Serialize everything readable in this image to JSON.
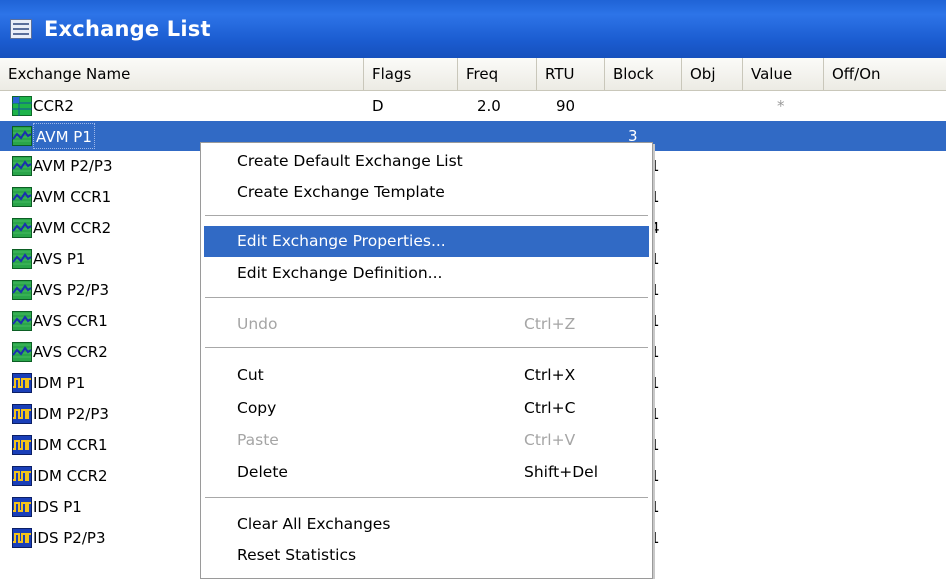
{
  "window": {
    "title": "Exchange List",
    "icon": "list-window-icon"
  },
  "columns": [
    "Exchange Name",
    "Flags",
    "Freq",
    "RTU",
    "Block",
    "Obj",
    "Value",
    "Off/On"
  ],
  "rows": [
    {
      "name": "CCR2",
      "icon": "grid-table-icon",
      "flags": "D",
      "freq": "2.0",
      "rtu": "90",
      "block": "",
      "obj": "",
      "value": "*",
      "selected": false
    },
    {
      "name": "AVM P1",
      "icon": "analog-wave-icon",
      "flags": "",
      "freq": "",
      "rtu": "",
      "block": "3",
      "obj": "",
      "value": "",
      "selected": true
    },
    {
      "name": "AVM P2/P3",
      "icon": "analog-wave-icon",
      "block": "1"
    },
    {
      "name": "AVM CCR1",
      "icon": "analog-wave-icon",
      "block": "1"
    },
    {
      "name": "AVM CCR2",
      "icon": "analog-wave-icon",
      "block": "4"
    },
    {
      "name": "AVS P1",
      "icon": "analog-wave-icon",
      "block": "1"
    },
    {
      "name": "AVS P2/P3",
      "icon": "analog-wave-icon",
      "block": "1"
    },
    {
      "name": "AVS CCR1",
      "icon": "analog-wave-icon",
      "block": "1"
    },
    {
      "name": "AVS CCR2",
      "icon": "analog-wave-icon",
      "block": "1"
    },
    {
      "name": "IDM P1",
      "icon": "digital-pulse-icon",
      "block": "1"
    },
    {
      "name": "IDM P2/P3",
      "icon": "digital-pulse-icon",
      "block": "1"
    },
    {
      "name": "IDM CCR1",
      "icon": "digital-pulse-icon",
      "block": "1"
    },
    {
      "name": "IDM CCR2",
      "icon": "digital-pulse-icon",
      "block": "1"
    },
    {
      "name": "IDS P1",
      "icon": "digital-pulse-icon",
      "block": "1"
    },
    {
      "name": "IDS P2/P3",
      "icon": "digital-pulse-icon",
      "block": "1"
    }
  ],
  "context_menu": {
    "items": [
      {
        "label": "Create Default Exchange List",
        "shortcut": "",
        "state": "normal"
      },
      {
        "label": "Create Exchange Template",
        "shortcut": "",
        "state": "normal"
      },
      {
        "label": "Edit Exchange Properties...",
        "shortcut": "",
        "state": "highlighted"
      },
      {
        "label": "Edit Exchange Definition...",
        "shortcut": "",
        "state": "normal"
      },
      {
        "label": "Undo",
        "shortcut": "Ctrl+Z",
        "state": "disabled"
      },
      {
        "label": "Cut",
        "shortcut": "Ctrl+X",
        "state": "normal"
      },
      {
        "label": "Copy",
        "shortcut": "Ctrl+C",
        "state": "normal"
      },
      {
        "label": "Paste",
        "shortcut": "Ctrl+V",
        "state": "disabled"
      },
      {
        "label": "Delete",
        "shortcut": "Shift+Del",
        "state": "normal"
      },
      {
        "label": "Clear All Exchanges",
        "shortcut": "",
        "state": "normal"
      },
      {
        "label": "Reset Statistics",
        "shortcut": "",
        "state": "normal"
      }
    ]
  },
  "colors": {
    "titlebar": "#2461d9",
    "selection": "#316ac5",
    "analog_icon": "#2aa54a",
    "digital_icon": "#1a3fb8"
  }
}
